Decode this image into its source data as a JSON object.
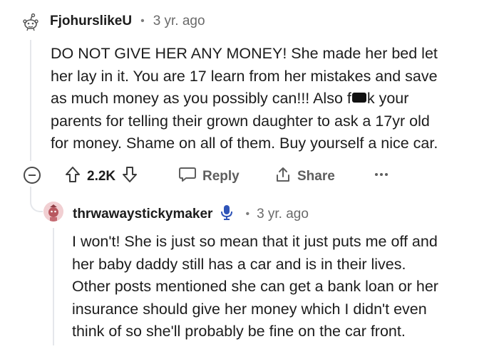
{
  "comment": {
    "username": "FjohurslikeU",
    "separator": "•",
    "timestamp": "3 yr. ago",
    "body_lines": [
      "DO NOT GIVE HER ANY MONEY! She made her bed let",
      "her lay in it. You are 17 learn from her mistakes and save",
      "as much money as you possibly can!!! Also f",
      "k your",
      "parents for telling their grown daughter to ask a 17yr old",
      "for money. Shame on all of them. Buy yourself a nice car."
    ],
    "vote_count": "2.2K",
    "reply_label": "Reply",
    "share_label": "Share",
    "icons": {
      "avatar": "snoo-avatar-icon",
      "collapse": "collapse-minus-icon",
      "upvote": "upvote-arrow-icon",
      "downvote": "downvote-arrow-icon",
      "reply": "speech-bubble-icon",
      "share": "share-icon",
      "more": "more-options-icon"
    }
  },
  "reply": {
    "username": "thrwawaystickymaker",
    "separator": "•",
    "timestamp": "3 yr. ago",
    "body_lines": [
      "I won't! She is just so mean that it just puts me off and",
      "her baby daddy still has a car and is in their lives.",
      "Other posts mentioned she can get a bank loan or her",
      "insurance should give her money which I didn't even",
      "think of so she'll probably be fine on the car front."
    ],
    "icons": {
      "avatar": "user-avatar-icon",
      "badge": "microphone-badge-icon"
    }
  }
}
